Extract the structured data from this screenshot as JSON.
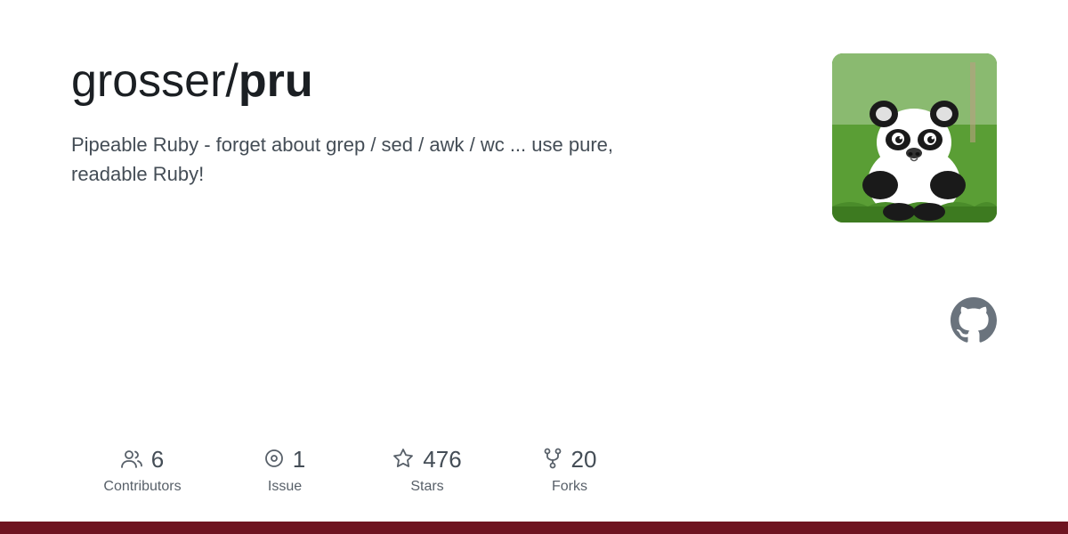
{
  "repo": {
    "owner": "grosser",
    "separator": "/",
    "name": "pru",
    "description": "Pipeable Ruby - forget about grep / sed / awk / wc ... use pure, readable Ruby!"
  },
  "stats": [
    {
      "id": "contributors",
      "icon": "👥",
      "count": "6",
      "label": "Contributors"
    },
    {
      "id": "issues",
      "icon": "⊙",
      "count": "1",
      "label": "Issue"
    },
    {
      "id": "stars",
      "icon": "☆",
      "count": "476",
      "label": "Stars"
    },
    {
      "id": "forks",
      "icon": "⑂",
      "count": "20",
      "label": "Forks"
    }
  ],
  "colors": {
    "bottom_bar": "#6e1420",
    "text_primary": "#1b1f23",
    "text_secondary": "#444d56",
    "icon_color": "#586069"
  }
}
